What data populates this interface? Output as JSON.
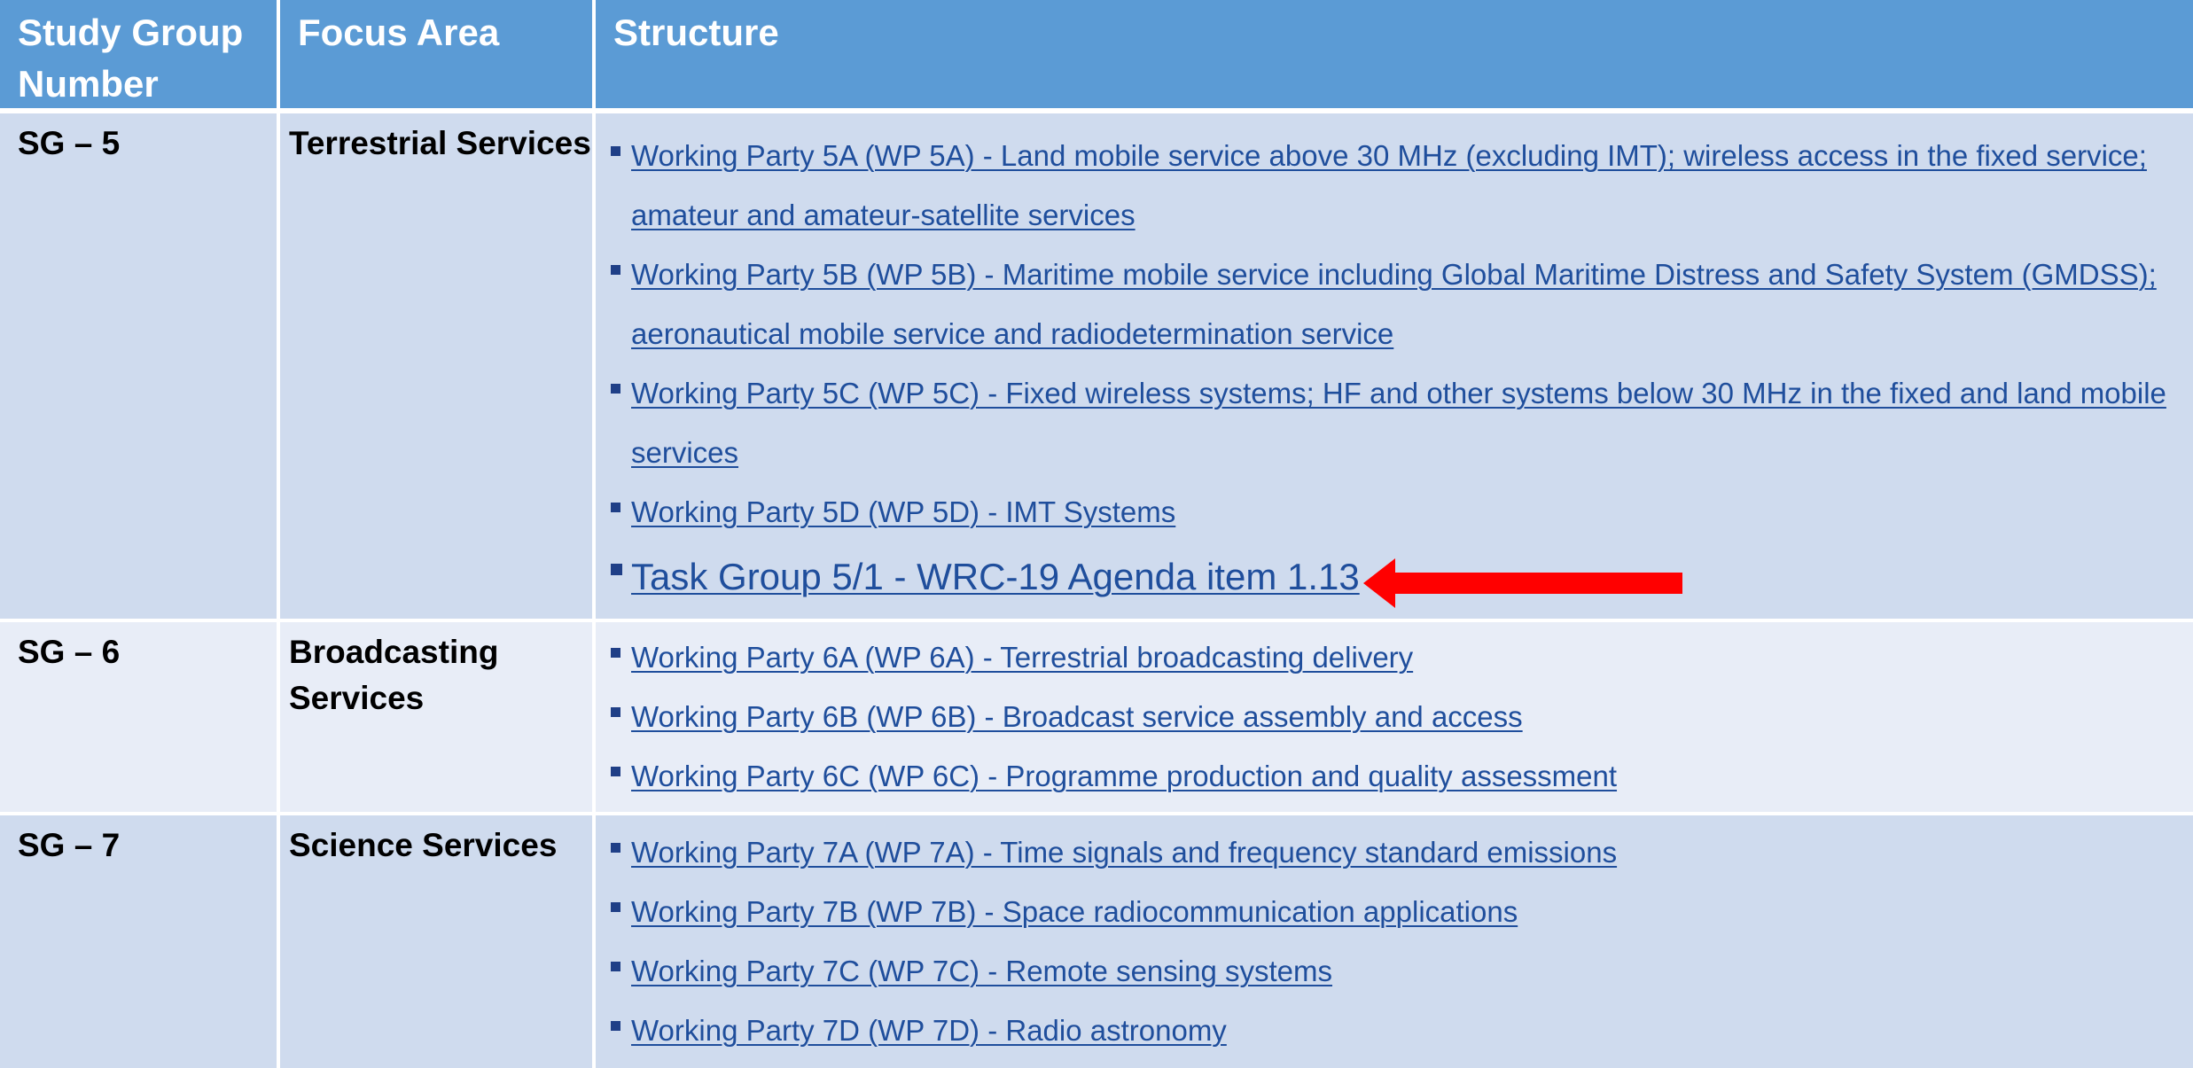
{
  "header": {
    "col1": "Study Group Number",
    "col2": "Focus Area",
    "col3": "Structure"
  },
  "rows": [
    {
      "sg": "SG – 5",
      "focus": "Terrestrial Services",
      "items": [
        "Working Party 5A (WP 5A) - Land mobile service above 30 MHz (excluding IMT); wireless access in the fixed service; amateur and amateur-satellite services",
        "Working Party 5B (WP 5B) - Maritime mobile service including Global Maritime Distress and Safety System (GMDSS); aeronautical mobile service and radiodetermination service",
        "Working Party 5C (WP 5C) - Fixed wireless systems; HF and other systems below 30 MHz in the fixed and land mobile services",
        "Working Party 5D (WP 5D) - IMT Systems",
        "Task Group 5/1 - WRC-19 Agenda item 1.13"
      ]
    },
    {
      "sg": "SG – 6",
      "focus": "Broadcasting Services",
      "items": [
        "Working Party 6A (WP 6A) - Terrestrial broadcasting delivery",
        "Working Party 6B (WP 6B) - Broadcast service assembly and access",
        "Working Party 6C (WP 6C) - Programme production and quality assessment"
      ]
    },
    {
      "sg": "SG – 7",
      "focus": "Science Services",
      "items": [
        "Working Party 7A (WP 7A) - Time signals and frequency standard emissions",
        "Working Party 7B (WP 7B) - Space radiocommunication applications",
        "Working Party 7C (WP 7C) - Remote sensing systems",
        "Working Party 7D (WP 7D) - Radio astronomy"
      ]
    }
  ],
  "colors": {
    "header_bg": "#5b9bd5",
    "row_dark": "#cfdbee",
    "row_light": "#e8edf7",
    "link": "#1f4e9c",
    "arrow": "#ff0000"
  },
  "annotation": {
    "icon": "red-left-arrow-icon",
    "points_to": "Task Group 5/1 - WRC-19 Agenda item 1.13"
  }
}
